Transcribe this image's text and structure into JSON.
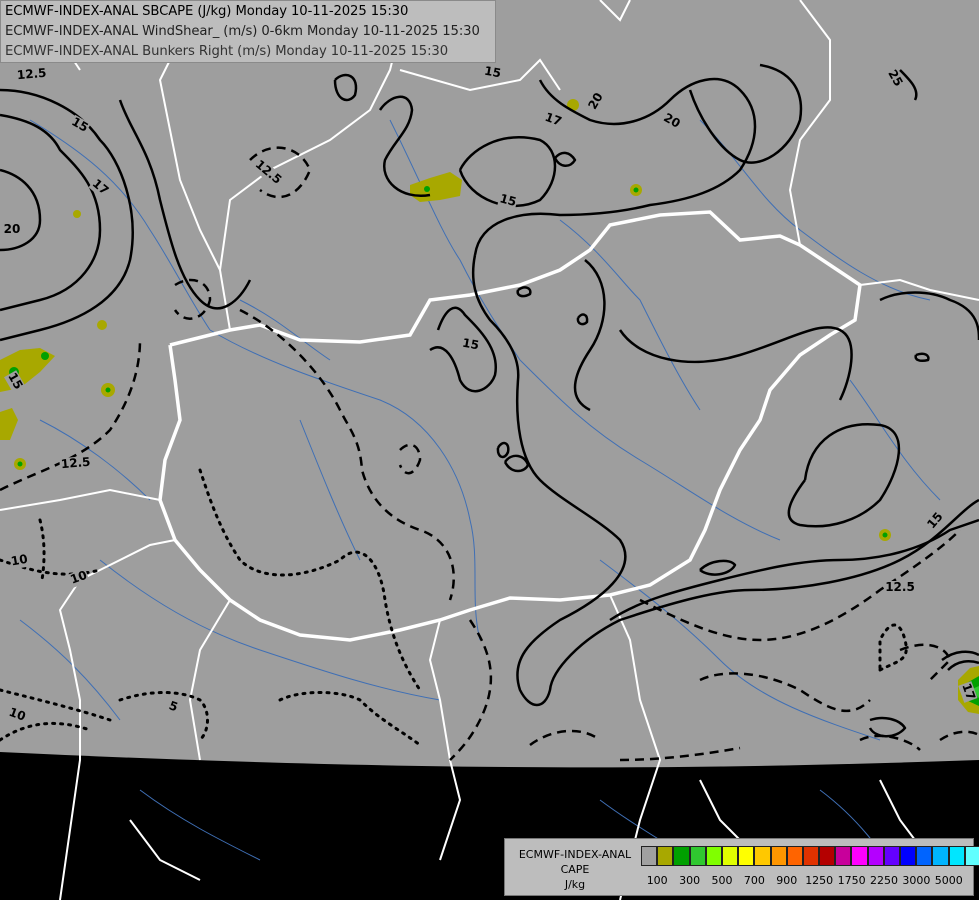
{
  "titles": [
    "ECMWF-INDEX-ANAL SBCAPE (J/kg) Monday 10-11-2025 15:30",
    "ECMWF-INDEX-ANAL WindShear_ (m/s) 0-6km Monday 10-11-2025 15:30",
    "ECMWF-INDEX-ANAL Bunkers Right (m/s) Monday 10-11-2025 15:30"
  ],
  "legend": {
    "model": "ECMWF-INDEX-ANAL",
    "field": "CAPE",
    "unit": "J/kg",
    "colors": [
      "#a0a0a0",
      "#a8a800",
      "#00a000",
      "#30c830",
      "#80ff00",
      "#e0ff00",
      "#ffff00",
      "#ffc800",
      "#ff9600",
      "#ff6400",
      "#e03200",
      "#b40000",
      "#c8009b",
      "#ff00ff",
      "#b400ff",
      "#6400ff",
      "#0000ff",
      "#0064ff",
      "#00b4ff",
      "#00e6ff",
      "#60ffff",
      "#ffffff"
    ],
    "ticks": [
      "100",
      "300",
      "500",
      "700",
      "900",
      "1250",
      "1750",
      "2250",
      "3000",
      "5000"
    ]
  },
  "contour_labels": [
    "12.5",
    "15",
    "17",
    "20",
    "25",
    "12.5",
    "15",
    "17",
    "20",
    "15",
    "20",
    "15",
    "12.5",
    "15",
    "17",
    "12.5",
    "10",
    "10",
    "10",
    "5",
    "15"
  ],
  "map": {
    "background": "#000000",
    "domain_fill": "#9e9e9e",
    "border_color": "#ffffff",
    "river_color": "#3f6fb5",
    "contour_color": "#000000"
  }
}
